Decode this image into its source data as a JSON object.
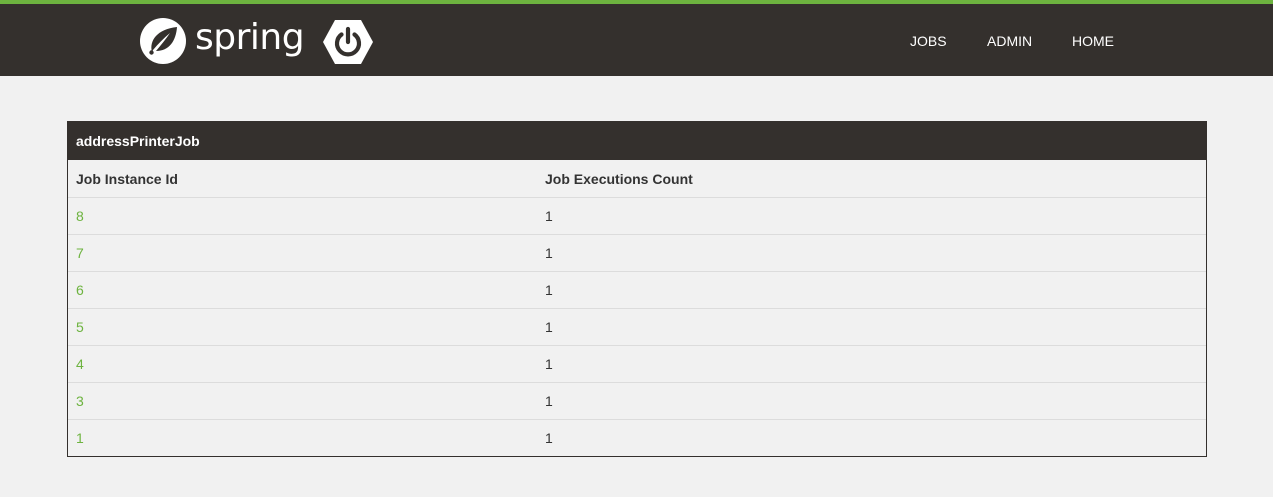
{
  "brand": {
    "wordmark": "spring",
    "leaf_icon": "spring-leaf-icon",
    "boot_icon": "spring-boot-power-icon",
    "accent_color": "#6db33f",
    "navbar_color": "#34302d"
  },
  "nav": {
    "items": [
      {
        "label": "JOBS"
      },
      {
        "label": "ADMIN"
      },
      {
        "label": "HOME"
      }
    ]
  },
  "job": {
    "name": "addressPrinterJob",
    "columns": {
      "instance_id": "Job Instance Id",
      "executions_count": "Job Executions Count"
    },
    "rows": [
      {
        "id": "8",
        "count": "1"
      },
      {
        "id": "7",
        "count": "1"
      },
      {
        "id": "6",
        "count": "1"
      },
      {
        "id": "5",
        "count": "1"
      },
      {
        "id": "4",
        "count": "1"
      },
      {
        "id": "3",
        "count": "1"
      },
      {
        "id": "1",
        "count": "1"
      }
    ]
  }
}
